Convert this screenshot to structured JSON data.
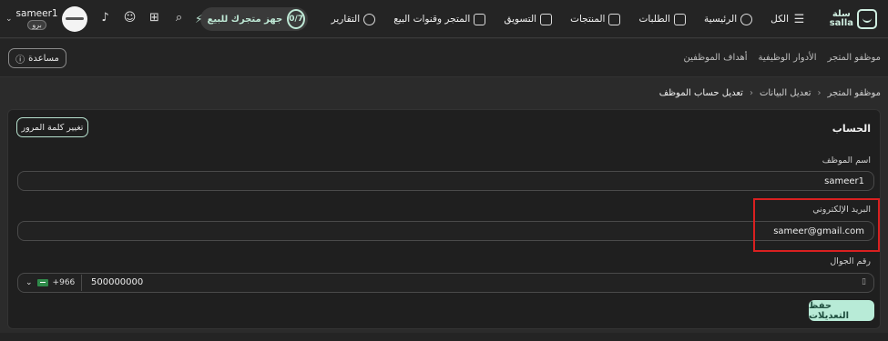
{
  "topbar": {
    "logo_text_line1": "سلة",
    "logo_text_line2": "salla",
    "nav": [
      {
        "label": "الكل",
        "icon": "menu-icon"
      },
      {
        "label": "الرئيسية",
        "icon": "home-icon"
      },
      {
        "label": "الطلبات",
        "icon": "orders-icon"
      },
      {
        "label": "المنتجات",
        "icon": "shirt-icon"
      },
      {
        "label": "التسويق",
        "icon": "megaphone-icon"
      },
      {
        "label": "المتجر وقنوات البيع",
        "icon": "store-channels-icon"
      },
      {
        "label": "التقارير",
        "icon": "reports-icon"
      }
    ],
    "ready": {
      "count": "0/7",
      "label": "جهز متجرك للبيع"
    },
    "icons": [
      "search-icon",
      "apps-grid-icon",
      "chat-icon",
      "bell-icon"
    ],
    "user": {
      "name": "sameer1",
      "badge": "برو"
    }
  },
  "subbar": {
    "help_label": "مساعدة",
    "tabs": [
      "موظفو المتجر",
      "الأدوار الوظيفية",
      "أهداف الموظفين"
    ]
  },
  "breadcrumb": [
    "موظفو المتجر",
    "تعديل البيانات",
    "تعديل حساب الموظف"
  ],
  "card": {
    "title": "الحساب",
    "change_password": "تغيير كلمة المرور",
    "name_label": "اسم الموظف",
    "name_value": "sameer1",
    "email_label": "البريد الإلكتروني",
    "email_value": "sameer@gmail.com",
    "phone_label": "رقم الجوال",
    "phone_code": "+966",
    "phone_value": "500000000",
    "save_label": "حفظ التعديلات"
  },
  "colors": {
    "accent": "#b8ebd7",
    "highlight": "#d92020",
    "background": "#2b2b2b"
  }
}
